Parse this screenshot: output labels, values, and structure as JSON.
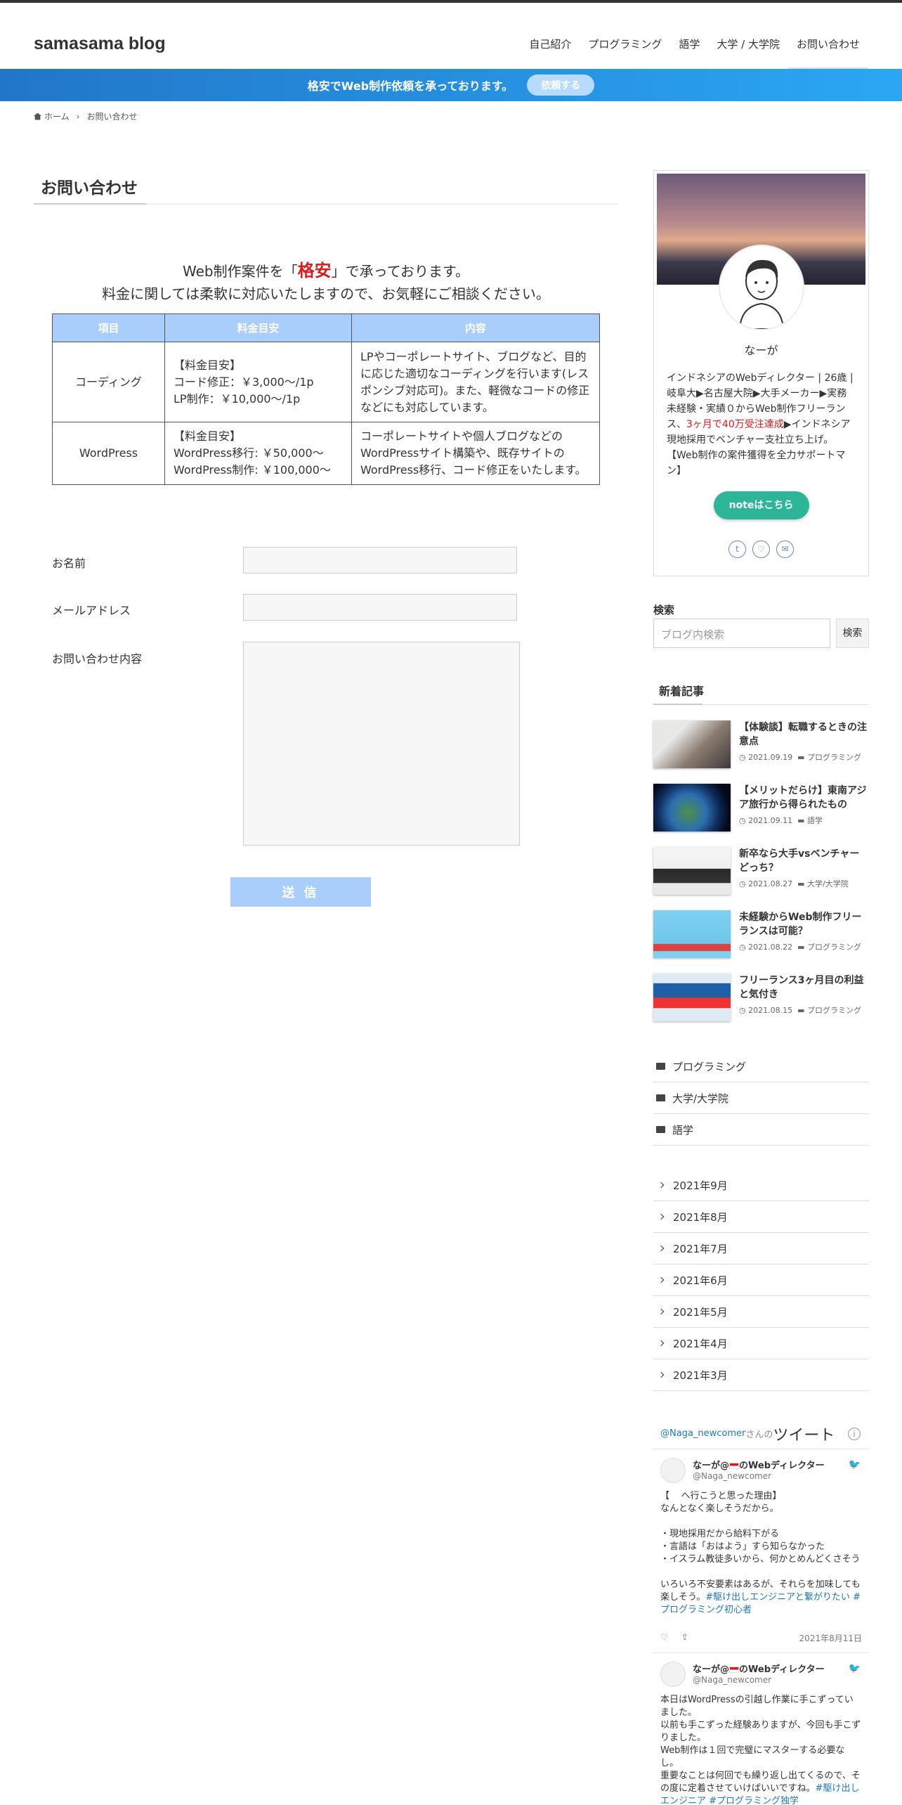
{
  "site": {
    "title": "samasama blog"
  },
  "nav": [
    "自己紹介",
    "プログラミング",
    "語学",
    "大学 / 大学院",
    "お問い合わせ"
  ],
  "ribbon": {
    "text": "格安でWeb制作依頼を承っております。",
    "button": "依頼する"
  },
  "breadcrumb": {
    "home": "ホーム",
    "current": "お問い合わせ"
  },
  "page": {
    "title": "お問い合わせ",
    "intro_pre": "Web制作案件を「",
    "intro_hl": "格安",
    "intro_post": "」で承っております。",
    "intro_line2": "料金に関しては柔軟に対応いたしますので、お気軽にご相談ください。"
  },
  "price_table": {
    "headers": [
      "項目",
      "料金目安",
      "内容"
    ],
    "rows": [
      {
        "item": "コーディング",
        "price": "【料金目安】\nコード修正：￥3,000〜/1p\nLP制作：￥10,000〜/1p",
        "content": "LPやコーポレートサイト、ブログなど、目的に応じた適切なコーディングを行います(レスポンシブ対応可)。また、軽微なコードの修正などにも対応しています。"
      },
      {
        "item": "WordPress",
        "price": "【料金目安】\nWordPress移行: ￥50,000〜\nWordPress制作: ￥100,000〜",
        "content": "コーポレートサイトや個人ブログなどのWordPressサイト構築や、既存サイトのWordPress移行、コード修正をいたします。"
      }
    ]
  },
  "form": {
    "name_label": "お名前",
    "email_label": "メールアドレス",
    "message_label": "お問い合わせ内容",
    "submit": "送 信"
  },
  "profile": {
    "name": "なーが",
    "bio_1": "インドネシアのWebディレクター | 26歳 | 岐阜大▶名古屋大院▶大手メーカー▶実務未経験・実績０からWeb制作フリーランス、",
    "bio_red": "3ヶ月で40万受注達成",
    "bio_2": "▶インドネシア現地採用でベンチャー支社立ち上げ。【Web制作の案件獲得を全力サポートマン】",
    "note_button": "noteはこちら"
  },
  "search": {
    "title": "検索",
    "placeholder": "ブログ内検索",
    "button": "検索"
  },
  "recent": {
    "title": "新着記事",
    "posts": [
      {
        "title": "【体験談】転職するときの注意点",
        "date": "2021.09.19",
        "cat": "プログラミング"
      },
      {
        "title": "【メリットだらけ】東南アジア旅行から得られたもの",
        "date": "2021.09.11",
        "cat": "語学"
      },
      {
        "title": "新卒なら大手vsベンチャーどっち？",
        "date": "2021.08.27",
        "cat": "大学/大学院"
      },
      {
        "title": "未経験からWeb制作フリーランスは可能？",
        "date": "2021.08.22",
        "cat": "プログラミング"
      },
      {
        "title": "フリーランス3ヶ月目の利益と気付き",
        "date": "2021.08.15",
        "cat": "プログラミング"
      }
    ]
  },
  "categories": [
    "プログラミング",
    "大学/大学院",
    "語学"
  ],
  "archives": [
    "2021年9月",
    "2021年8月",
    "2021年7月",
    "2021年6月",
    "2021年5月",
    "2021年4月",
    "2021年3月"
  ],
  "twitter": {
    "handle_link": "@Naga_newcomer",
    "san": "さんの",
    "header_big": "ツイート",
    "user_name_pre": "なーが@",
    "user_name_post": "のWebディレクター",
    "user_handle": "@Naga_newcomer",
    "tweet1_body": "【    へ行こうと思った理由】\nなんとなく楽しそうだから。\n\n・現地採用だから給料下がる\n・言語は「おはよう」すら知らなかった\n・イスラム教徒多いから、何かとめんどくさそう\n\nいろいろ不安要素はあるが、それらを加味しても楽しそう。",
    "tweet1_tags": "#駆け出しエンジニアと繋がりたい #プログラミング初心者",
    "tweet1_date": "2021年8月11日",
    "tweet2_body": "本日はWordPressの引越し作業に手こずっていました。\n以前も手こずった経験ありますが、今回も手こずりました。\nWeb制作は１回で完璧にマスターする必要なし。\n重要なことは何回でも繰り返し出てくるので、その度に定着させていけばいいですね。",
    "tweet2_tags": "#駆け出しエンジニア #プログラミング独学"
  }
}
